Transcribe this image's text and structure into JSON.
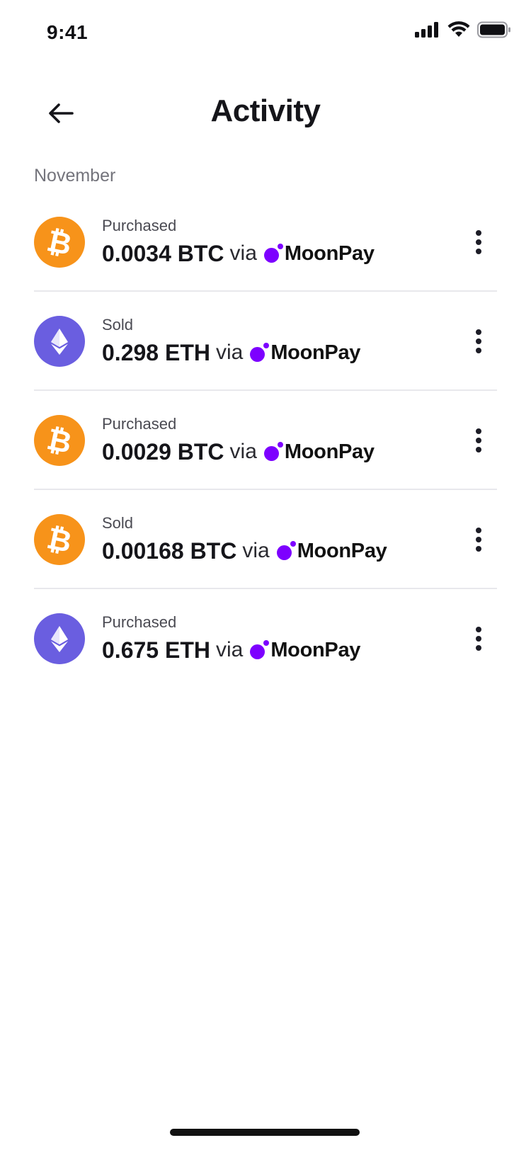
{
  "status_bar": {
    "time": "9:41"
  },
  "header": {
    "title": "Activity"
  },
  "section": {
    "label": "November"
  },
  "colors": {
    "btc": "#f7931a",
    "eth": "#6a5ee0",
    "moonpay": "#7d00ff"
  },
  "transactions": [
    {
      "type": "Purchased",
      "amount": "0.0034 BTC",
      "via": "via",
      "provider": "MoonPay",
      "coin_icon": "bitcoin-icon"
    },
    {
      "type": "Sold",
      "amount": "0.298 ETH",
      "via": "via",
      "provider": "MoonPay",
      "coin_icon": "ethereum-icon"
    },
    {
      "type": "Purchased",
      "amount": "0.0029 BTC",
      "via": "via",
      "provider": "MoonPay",
      "coin_icon": "bitcoin-icon"
    },
    {
      "type": "Sold",
      "amount": "0.00168 BTC",
      "via": "via",
      "provider": "MoonPay",
      "coin_icon": "bitcoin-icon"
    },
    {
      "type": "Purchased",
      "amount": "0.675 ETH",
      "via": "via",
      "provider": "MoonPay",
      "coin_icon": "ethereum-icon"
    }
  ]
}
